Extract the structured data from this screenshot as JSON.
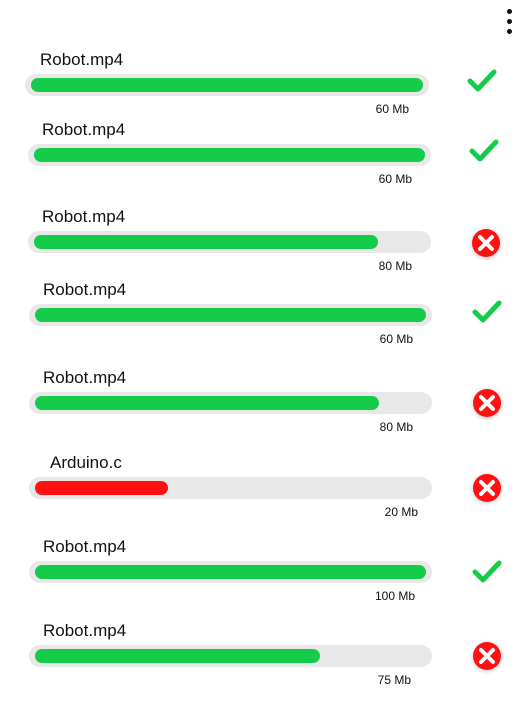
{
  "colors": {
    "success": "#15cc4a",
    "error": "#ff1111",
    "track": "#e8e8e8"
  },
  "menu": {
    "icon": "more-vertical-icon"
  },
  "files": [
    {
      "name": "Robot.mp4",
      "size": "60 Mb",
      "progress": 1.0,
      "status": "done"
    },
    {
      "name": "Robot.mp4",
      "size": "60 Mb",
      "progress": 1.0,
      "status": "done"
    },
    {
      "name": "Robot.mp4",
      "size": "80 Mb",
      "progress": 0.88,
      "status": "failed"
    },
    {
      "name": "Robot.mp4",
      "size": "60 Mb",
      "progress": 1.0,
      "status": "done"
    },
    {
      "name": "Robot.mp4",
      "size": "80 Mb",
      "progress": 0.88,
      "status": "failed"
    },
    {
      "name": "Arduino.c",
      "size": "20 Mb",
      "progress": 0.34,
      "status": "failed"
    },
    {
      "name": "Robot.mp4",
      "size": "100 Mb",
      "progress": 1.0,
      "status": "done"
    },
    {
      "name": "Robot.mp4",
      "size": "75 Mb",
      "progress": 0.73,
      "status": "failed"
    }
  ]
}
